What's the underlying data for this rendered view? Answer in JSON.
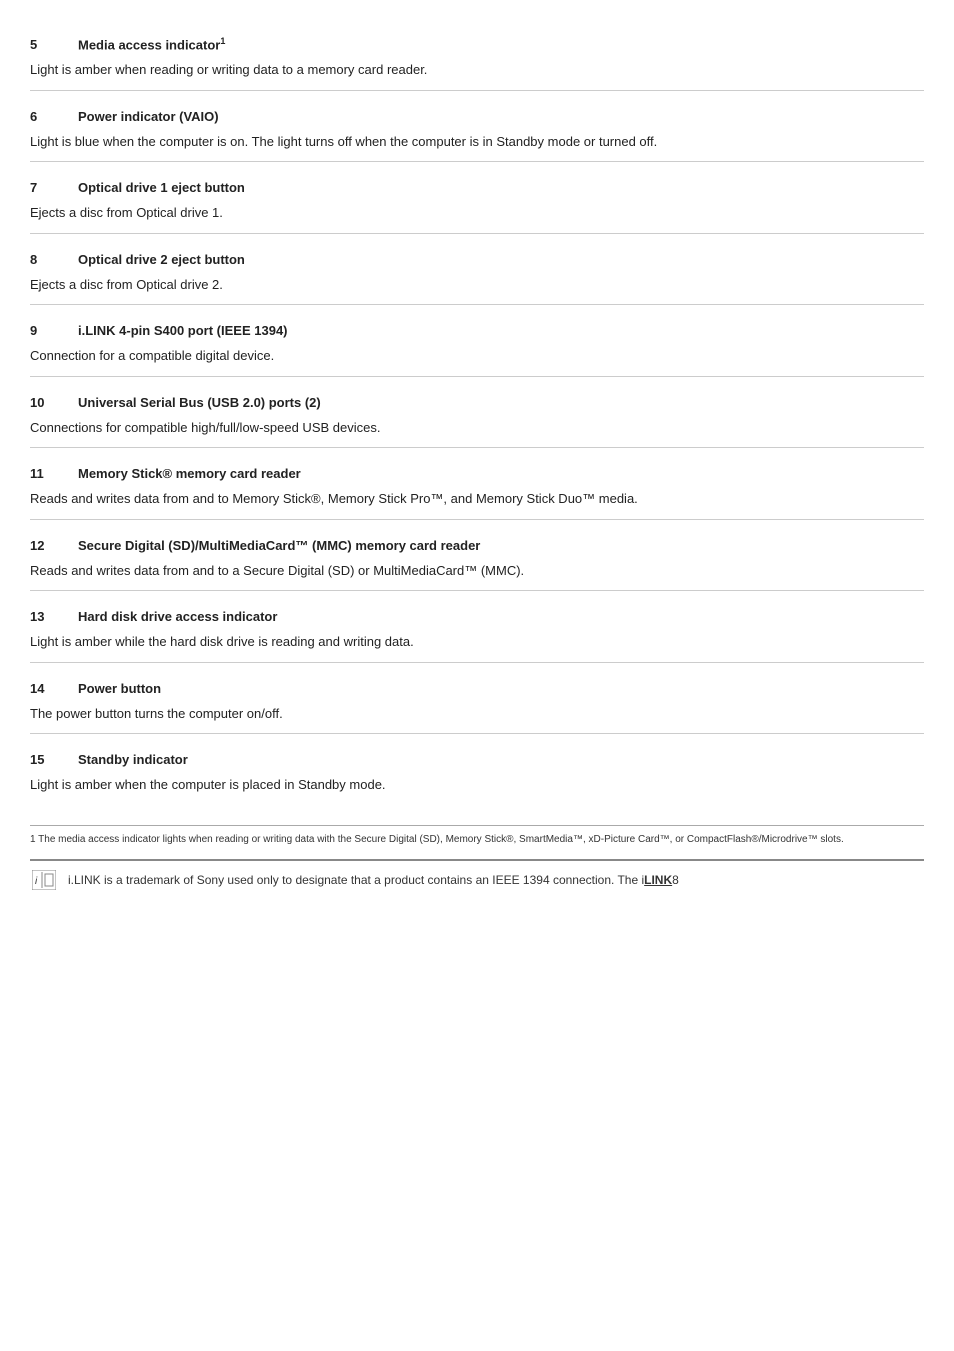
{
  "sections": [
    {
      "number": "5",
      "title": "Media access indicator",
      "title_sup": "1",
      "body": "Light is amber when reading or writing data to a memory card reader."
    },
    {
      "number": "6",
      "title": "Power indicator (VAIO)",
      "title_sup": "",
      "body": "Light is blue when the computer is on. The light turns off when the computer is in Standby mode or turned off."
    },
    {
      "number": "7",
      "title": "Optical drive 1 eject button",
      "title_sup": "",
      "body": "Ejects a disc from Optical drive 1."
    },
    {
      "number": "8",
      "title": "Optical drive 2 eject button",
      "title_sup": "",
      "body": "Ejects a disc from Optical drive 2."
    },
    {
      "number": "9",
      "title": "i.LINK 4-pin S400 port (IEEE 1394)",
      "title_sup": "",
      "body": "Connection for a compatible digital device."
    },
    {
      "number": "10",
      "title": "Universal Serial Bus (USB 2.0) ports (2)",
      "title_sup": "",
      "body": "Connections for compatible high/full/low-speed USB devices."
    },
    {
      "number": "11",
      "title": "Memory Stick® memory card reader",
      "title_sup": "",
      "body_html": true,
      "body": "Reads and writes data from and to Memory Stick®, Memory Stick Pro™, and Memory Stick Duo™ media."
    },
    {
      "number": "12",
      "title": "Secure Digital (SD)/MultiMediaCard™ (MMC) memory card reader",
      "title_sup": "",
      "body": "Reads and writes data from and to a Secure Digital (SD) or MultiMediaCard™ (MMC)."
    },
    {
      "number": "13",
      "title": "Hard disk drive access indicator",
      "title_sup": "",
      "body": "Light is amber while the hard disk drive is reading and writing data."
    },
    {
      "number": "14",
      "title": "Power button",
      "title_sup": "",
      "body": "The power button turns the computer on/off."
    },
    {
      "number": "15",
      "title": "Standby indicator",
      "title_sup": "",
      "body": "Light is amber when the computer is placed in Standby mode."
    }
  ],
  "footnote": "1 The media access indicator lights when reading or writing data with the Secure Digital (SD), Memory Stick®, SmartMedia™, xD-Picture Card™, or CompactFlash®/Microdrive™ slots.",
  "footer_text": "i.LINK is a trademark of Sony used only to designate that a product contains an IEEE 1394 connection. The i",
  "footer_text2": "LINK",
  "footer_text3": "8"
}
